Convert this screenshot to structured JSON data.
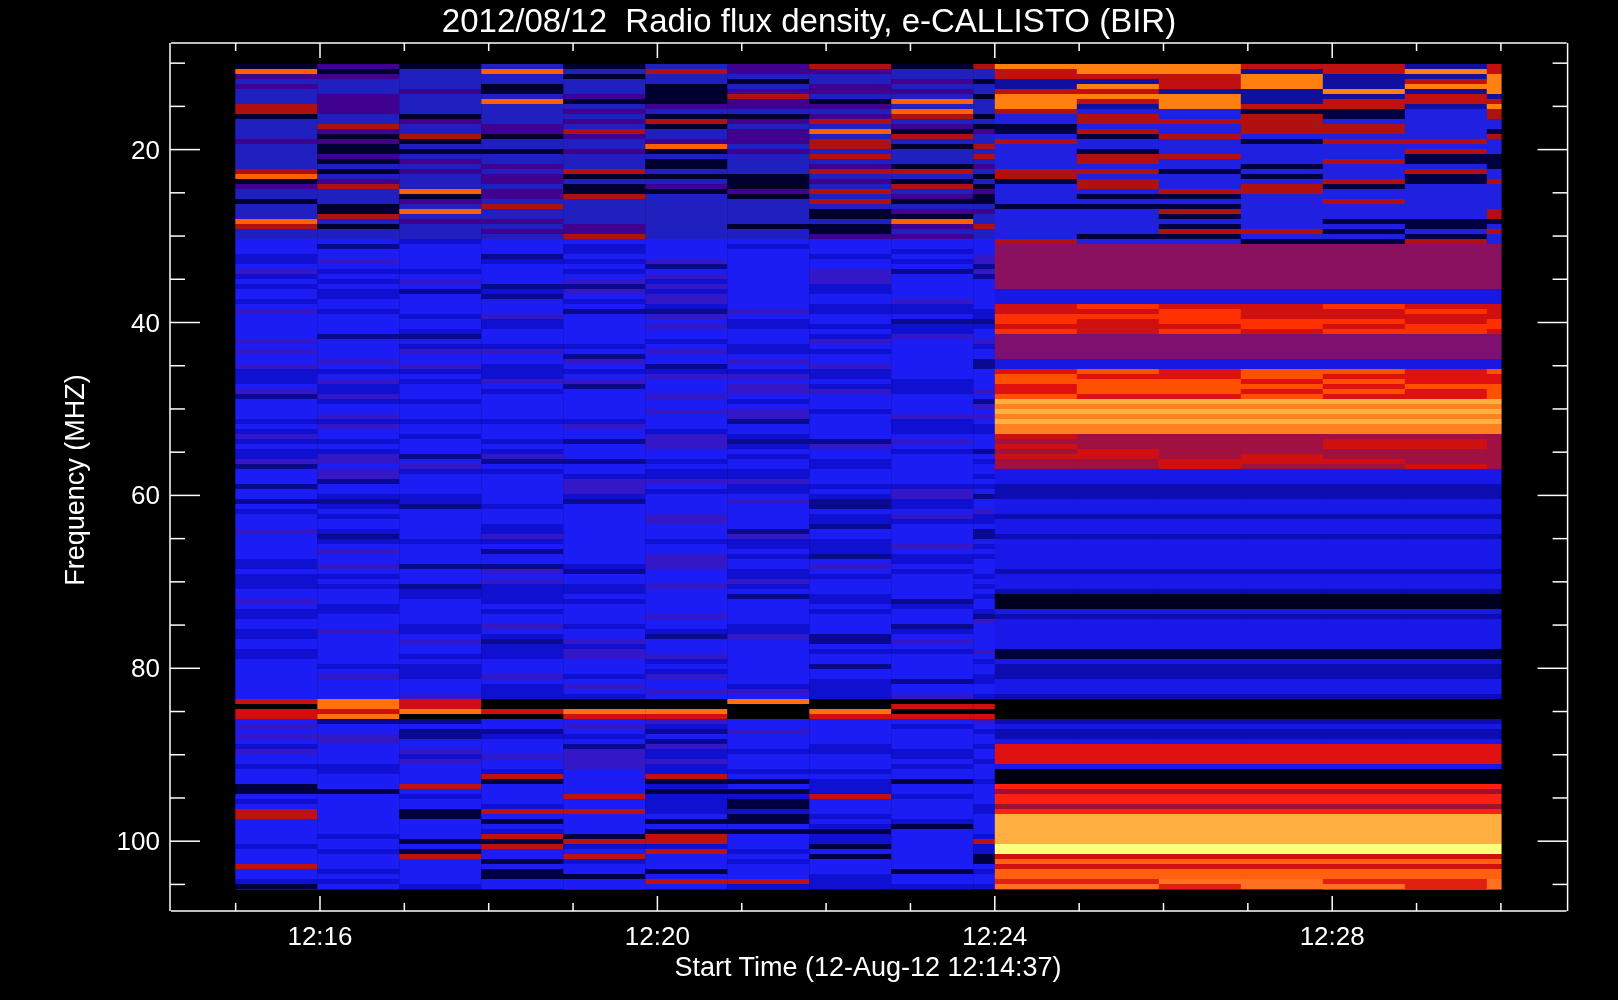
{
  "title": "2012/08/12  Radio flux density, e-CALLISTO (BIR)",
  "y_axis": {
    "label": "Frequency (MHZ)",
    "ticks": [
      "20",
      "40",
      "60",
      "80",
      "100"
    ]
  },
  "x_axis": {
    "label": "Start Time (12-Aug-12 12:14:37)",
    "ticks": [
      "12:16",
      "12:20",
      "12:24",
      "12:28"
    ]
  }
}
